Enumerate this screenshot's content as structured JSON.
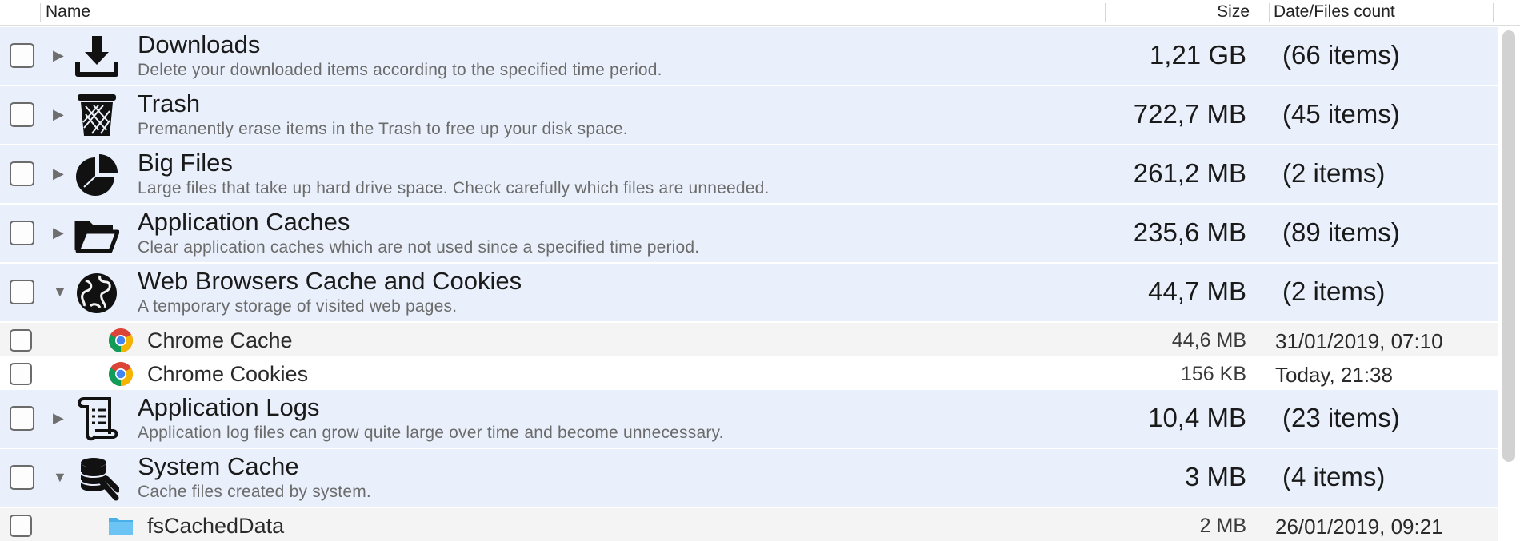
{
  "header": {
    "name": "Name",
    "size": "Size",
    "date": "Date/Files count"
  },
  "rows": [
    {
      "kind": "category",
      "icon": "download-icon",
      "expanded": false,
      "title": "Downloads",
      "desc": "Delete your downloaded items according to the specified time period.",
      "size": "1,21 GB",
      "count": "(66 items)"
    },
    {
      "kind": "category",
      "icon": "trash-icon",
      "expanded": false,
      "title": "Trash",
      "desc": "Premanently erase items in the Trash to free up your disk space.",
      "size": "722,7 MB",
      "count": "(45 items)"
    },
    {
      "kind": "category",
      "icon": "pie-chart-icon",
      "expanded": false,
      "title": "Big Files",
      "desc": "Large files that take up hard drive space. Check carefully which files are unneeded.",
      "size": "261,2 MB",
      "count": "(2 items)"
    },
    {
      "kind": "category",
      "icon": "folder-icon",
      "expanded": false,
      "title": "Application Caches",
      "desc": "Clear application caches which are not used since a specified time period.",
      "size": "235,6 MB",
      "count": "(89 items)"
    },
    {
      "kind": "category",
      "icon": "globe-icon",
      "expanded": true,
      "title": "Web Browsers Cache and Cookies",
      "desc": "A temporary storage of visited web pages.",
      "size": "44,7 MB",
      "count": "(2 items)"
    },
    {
      "kind": "item",
      "icon": "chrome-icon",
      "shade": "grey",
      "name": "Chrome Cache",
      "size": "44,6 MB",
      "date": "31/01/2019, 07:10"
    },
    {
      "kind": "item",
      "icon": "chrome-icon",
      "shade": "white",
      "name": "Chrome Cookies",
      "size": "156 KB",
      "date": "Today, 21:38"
    },
    {
      "kind": "category",
      "icon": "scroll-icon",
      "expanded": false,
      "title": "Application Logs",
      "desc": "Application log files can grow quite large over time and become unnecessary.",
      "size": "10,4 MB",
      "count": "(23 items)"
    },
    {
      "kind": "category",
      "icon": "database-icon",
      "expanded": true,
      "title": "System Cache",
      "desc": "Cache files created by system.",
      "size": "3 MB",
      "count": "(4 items)"
    },
    {
      "kind": "item",
      "icon": "blue-folder-icon",
      "shade": "grey",
      "name": "fsCachedData",
      "size": "2 MB",
      "date": "26/01/2019, 09:21"
    }
  ]
}
